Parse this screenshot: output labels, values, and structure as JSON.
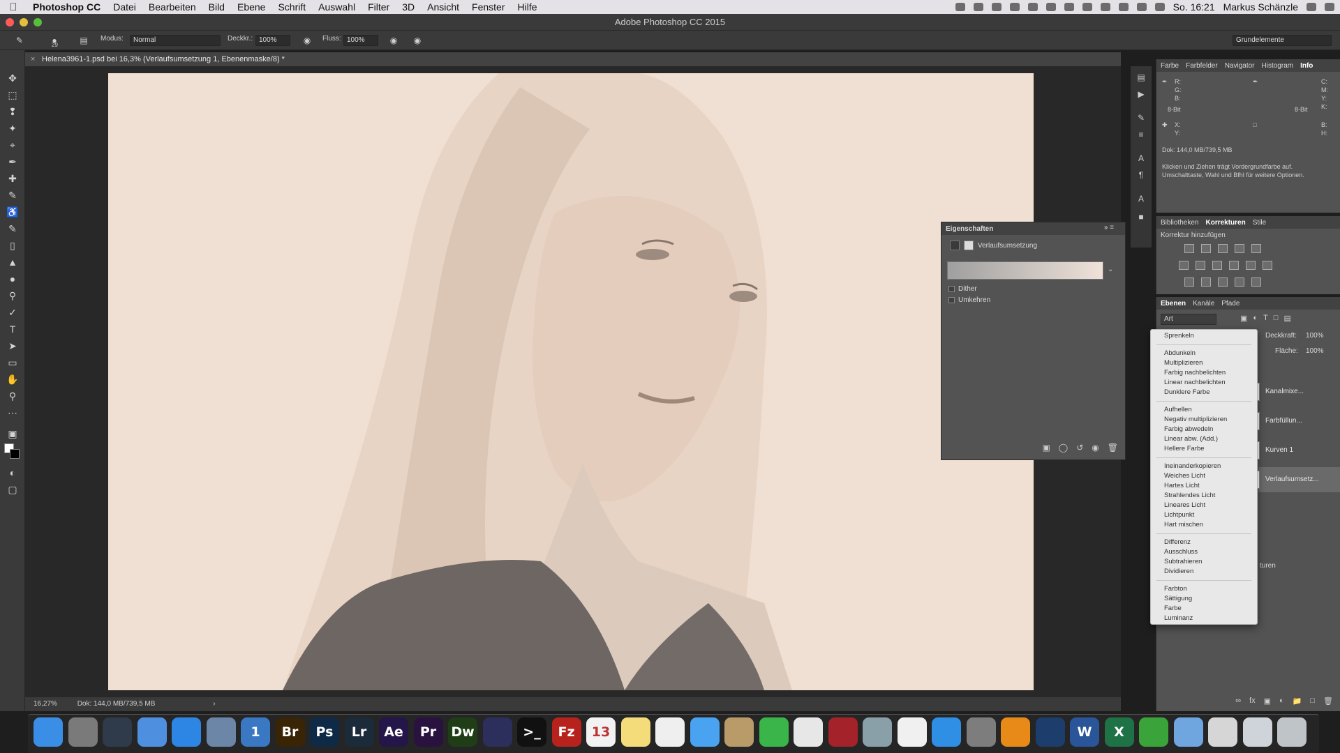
{
  "menubar": {
    "app": "Photoshop CC",
    "items": [
      "Datei",
      "Bearbeiten",
      "Bild",
      "Ebene",
      "Schrift",
      "Auswahl",
      "Filter",
      "3D",
      "Ansicht",
      "Fenster",
      "Hilfe"
    ],
    "clock": "So. 16:21",
    "user": "Markus Schänzle"
  },
  "window": {
    "title": "Adobe Photoshop CC 2015"
  },
  "options_bar": {
    "brush_size": "29",
    "mode_label": "Modus:",
    "mode_value": "Normal",
    "opacity_label": "Deckkr.:",
    "opacity_value": "100%",
    "flow_label": "Fluss:",
    "flow_value": "100%",
    "workspace": "Grundelemente"
  },
  "document": {
    "tab_title": "Helena3961-1.psd bei 16,3% (Verlaufsumsetzung 1, Ebenenmaske/8) *",
    "zoom": "16,27%",
    "doc_size": "Dok: 144,0 MB/739,5 MB"
  },
  "properties": {
    "title": "Eigenschaften",
    "adjustment_name": "Verlaufsumsetzung",
    "dither_label": "Dither",
    "reverse_label": "Umkehren"
  },
  "info_panel": {
    "tabs": [
      "Farbe",
      "Farbfelder",
      "Navigator",
      "Histogram",
      "Info"
    ],
    "active_tab": "Info",
    "rgb_labels": "R:\nG:\nB:",
    "cmyk_labels": "C:\nM:\nY:\nK:",
    "bit_left": "8-Bit",
    "bit_right": "8-Bit",
    "xy_labels": "X:\nY:",
    "bh_labels": "B:\nH:",
    "doc_size": "Dok: 144,0 MB/739,5 MB",
    "hint": "Klicken und Ziehen trägt Vordergrundfarbe auf. Umschalttaste, Wahl und Bfhl für weitere Optionen."
  },
  "adjustments_panel": {
    "tabs": [
      "Bibliotheken",
      "Korrekturen",
      "Stile"
    ],
    "active_tab": "Korrekturen",
    "heading": "Korrektur hinzufügen"
  },
  "layers_panel": {
    "tabs": [
      "Ebenen",
      "Kanäle",
      "Pfade"
    ],
    "active_tab": "Ebenen",
    "filter_value": "Art",
    "opacity_label": "Deckkraft:",
    "opacity_value": "100%",
    "fill_label": "Fläche:",
    "fill_value": "100%",
    "layers": [
      {
        "name": "Kanalmixe..."
      },
      {
        "name": "Farbfüllun..."
      },
      {
        "name": "Kurven 1"
      },
      {
        "name": "Verlaufsumsetz..."
      }
    ],
    "partial_label": "turen"
  },
  "blend_menu": {
    "groups": [
      [
        "Sprenkeln"
      ],
      [
        "Abdunkeln",
        "Multiplizieren",
        "Farbig nachbelichten",
        "Linear nachbelichten",
        "Dunklere Farbe"
      ],
      [
        "Aufhellen",
        "Negativ multiplizieren",
        "Farbig abwedeln",
        "Linear abw. (Add.)",
        "Hellere Farbe"
      ],
      [
        "Ineinanderkopieren",
        "Weiches Licht",
        "Hartes Licht",
        "Strahlendes Licht",
        "Lineares Licht",
        "Lichtpunkt",
        "Hart mischen"
      ],
      [
        "Differenz",
        "Ausschluss",
        "Subtrahieren",
        "Dividieren"
      ],
      [
        "Farbton",
        "Sättigung",
        "Farbe",
        "Luminanz"
      ]
    ]
  },
  "dock_apps": [
    {
      "label": "",
      "name": "finder",
      "color": "#3b8ee6"
    },
    {
      "label": "",
      "name": "launchpad",
      "color": "#7a7a7a"
    },
    {
      "label": "",
      "name": "mission-control",
      "color": "#2f3a4a"
    },
    {
      "label": "",
      "name": "files",
      "color": "#4f8fe0"
    },
    {
      "label": "",
      "name": "safari",
      "color": "#2d86e4"
    },
    {
      "label": "",
      "name": "preview",
      "color": "#6c86a8"
    },
    {
      "label": "1",
      "name": "1password",
      "color": "#3a78c4"
    },
    {
      "label": "Br",
      "name": "bridge",
      "color": "#3a2406"
    },
    {
      "label": "Ps",
      "name": "photoshop",
      "color": "#0e2a47"
    },
    {
      "label": "Lr",
      "name": "lightroom",
      "color": "#1c2b3a"
    },
    {
      "label": "Ae",
      "name": "after-effects",
      "color": "#25164a"
    },
    {
      "label": "Pr",
      "name": "premiere",
      "color": "#2a1240"
    },
    {
      "label": "Dw",
      "name": "dreamweaver",
      "color": "#1f3d16"
    },
    {
      "label": "",
      "name": "imovie",
      "color": "#2c2f5c"
    },
    {
      "label": ">_",
      "name": "terminal",
      "color": "#111111"
    },
    {
      "label": "Fz",
      "name": "filezilla",
      "color": "#b7221d"
    },
    {
      "label": "13",
      "name": "calendar",
      "color": "#f2f2f2"
    },
    {
      "label": "",
      "name": "notes",
      "color": "#f5dc7a"
    },
    {
      "label": "",
      "name": "reminders",
      "color": "#efefef"
    },
    {
      "label": "",
      "name": "messages",
      "color": "#4aa3f0"
    },
    {
      "label": "",
      "name": "contacts",
      "color": "#b99b6a"
    },
    {
      "label": "",
      "name": "facetime",
      "color": "#3ab54a"
    },
    {
      "label": "",
      "name": "photos",
      "color": "#e7e7e7"
    },
    {
      "label": "",
      "name": "photo-booth",
      "color": "#a4232a"
    },
    {
      "label": "",
      "name": "image-capture",
      "color": "#8aa0a8"
    },
    {
      "label": "",
      "name": "itunes",
      "color": "#f0f0f0"
    },
    {
      "label": "",
      "name": "app-store",
      "color": "#2f8fe5"
    },
    {
      "label": "",
      "name": "system-preferences",
      "color": "#7d7d7d"
    },
    {
      "label": "",
      "name": "vlc",
      "color": "#e88a18"
    },
    {
      "label": "",
      "name": "quicktime",
      "color": "#1d3d6c"
    },
    {
      "label": "W",
      "name": "word",
      "color": "#2a5598"
    },
    {
      "label": "X",
      "name": "excel",
      "color": "#1f7245"
    },
    {
      "label": "",
      "name": "evernote",
      "color": "#3aa33a"
    },
    {
      "label": "",
      "name": "applications-folder",
      "color": "#6fa6e0"
    },
    {
      "label": "",
      "name": "brushes-folder",
      "color": "#d6d6d6"
    },
    {
      "label": "",
      "name": "documents-folder",
      "color": "#cfd4da"
    },
    {
      "label": "",
      "name": "trash",
      "color": "#bfc4c9"
    }
  ]
}
